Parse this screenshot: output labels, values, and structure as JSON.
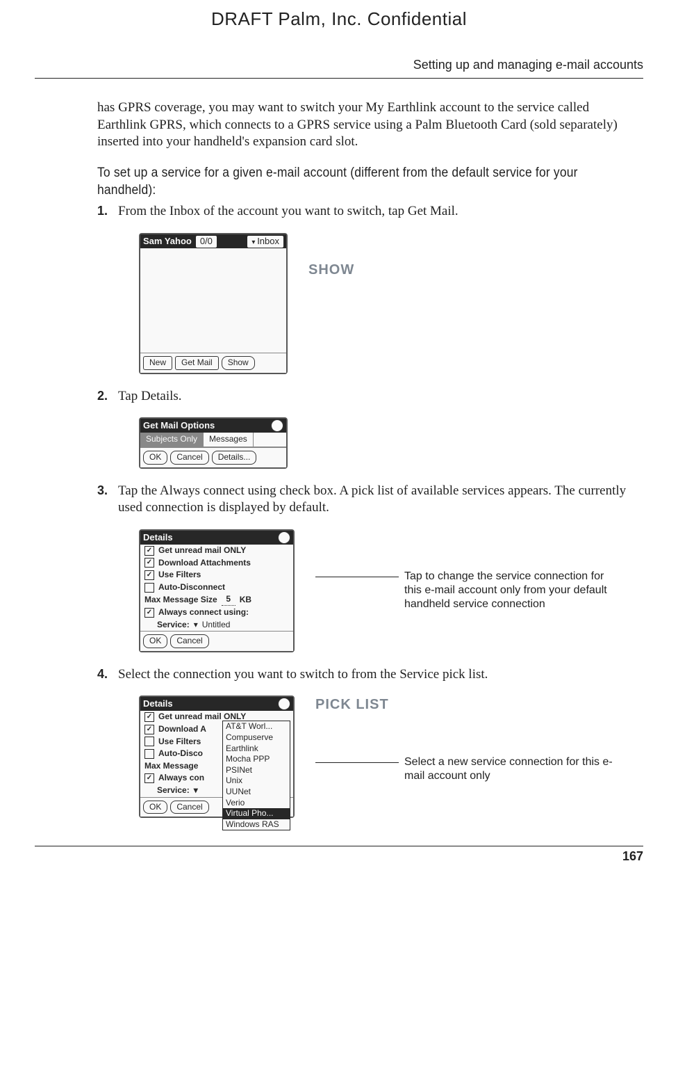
{
  "header": {
    "draft": "DRAFT   Palm, Inc. Confidential",
    "section_title": "Setting up and managing e-mail accounts"
  },
  "intro": "has GPRS coverage, you may want to switch your My Earthlink account to the service called Earthlink GPRS, which connects to a GPRS service using a Palm Bluetooth Card (sold separately) inserted into your handheld's expansion card slot.",
  "subheading": "To set up a service for a given e-mail account (different from the default service for your handheld):",
  "steps": {
    "s1": "From the Inbox of the account you want to switch, tap Get Mail.",
    "s2": "Tap Details.",
    "s3": "Tap the Always connect using check box. A pick list of available services appears. The currently used connection is displayed by default.",
    "s4": "Select the connection you want to switch to from the Service pick list."
  },
  "callouts": {
    "show": "SHOW",
    "picklist": "PICK LIST",
    "change_service": "Tap to change the service connection for this e-mail account only from your default handheld service connection",
    "select_new": "Select a new service connection for this e-mail account only"
  },
  "shots": {
    "inbox": {
      "account": "Sam Yahoo",
      "count": "0/0",
      "folder": "Inbox",
      "btn_new": "New",
      "btn_get": "Get Mail",
      "btn_show": "Show"
    },
    "getmail": {
      "title": "Get Mail Options",
      "tab_subjects": "Subjects Only",
      "tab_messages": "Messages",
      "btn_ok": "OK",
      "btn_cancel": "Cancel",
      "btn_details": "Details..."
    },
    "details": {
      "title": "Details",
      "row_unread": "Get unread mail ONLY",
      "row_dl": "Download Attachments",
      "row_filters": "Use Filters",
      "row_auto": "Auto-Disconnect",
      "row_max_label": "Max Message Size",
      "row_max_val": "5",
      "row_max_unit": "KB",
      "row_always": "Always connect using:",
      "row_service_label": "Service:",
      "row_service_val": "Untitled",
      "btn_ok": "OK",
      "btn_cancel": "Cancel"
    },
    "picklist": {
      "title": "Details",
      "row_unread": "Get unread mail ONLY",
      "row_dl": "Download A",
      "row_filters": "Use Filters",
      "row_auto": "Auto-Disco",
      "row_max_label": "Max Message",
      "row_always": "Always con",
      "row_service_label": "Service:",
      "options": [
        "AT&T Worl...",
        "Compuserve",
        "Earthlink",
        "Mocha PPP",
        "PSINet",
        "Unix",
        "UUNet",
        "Verio",
        "Virtual Pho...",
        "Windows RAS"
      ],
      "selected_index": 8,
      "btn_ok": "OK",
      "btn_cancel": "Cancel"
    }
  },
  "page_number": "167"
}
